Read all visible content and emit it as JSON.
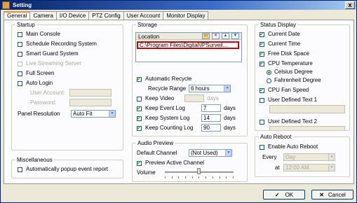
{
  "window": {
    "title": "Setting",
    "close_label": "x"
  },
  "tabs": [
    "General",
    "Camera",
    "I/O Device",
    "PTZ Config",
    "User Account",
    "Monitor Display"
  ],
  "startup": {
    "title": "Startup",
    "items": [
      {
        "label": "Main Console",
        "checked": false,
        "disabled": false
      },
      {
        "label": "Schedule Recording System",
        "checked": false,
        "disabled": false
      },
      {
        "label": "Smart Guard System",
        "checked": false,
        "disabled": false
      },
      {
        "label": "Live Streaming Server",
        "checked": false,
        "disabled": true
      },
      {
        "label": "Full Screen",
        "checked": false,
        "disabled": false
      },
      {
        "label": "Auto Login",
        "checked": false,
        "disabled": false
      }
    ],
    "user_account_label": "User Account:",
    "password_label": "Password:",
    "panel_resolution_label": "Panel Resolution",
    "panel_resolution_value": "Auto Fit"
  },
  "misc": {
    "title": "Miscellaneous",
    "popup_label": "Automatically popup event report"
  },
  "storage": {
    "title": "Storage",
    "location_header": "Location",
    "location_path": "C:\\Program Files\\Digital\\IPSurveil...",
    "toolbar_icons": [
      "folder-icon",
      "delete-icon",
      "up-icon",
      "down-icon"
    ],
    "auto_recycle_label": "Automatic Recycle",
    "recycle_range_label": "Recycle Range",
    "recycle_range_value": "6 hours",
    "keep_video_label": "Keep Video",
    "keep_video_value": "",
    "keep_event_label": "Keep Event Log",
    "keep_event_value": "7",
    "keep_system_label": "Keep System Log",
    "keep_system_value": "14",
    "keep_counting_label": "Keep Counting Log",
    "keep_counting_value": "90",
    "days_label": "days"
  },
  "audio": {
    "title": "Audio Preview",
    "default_channel_label": "Default Channel",
    "default_channel_value": "(Not Used)",
    "preview_label": "Preview Active Channel",
    "volume_label": "Volume",
    "volume_level": 0.5
  },
  "status": {
    "title": "Status Display",
    "current_date": "Current Date",
    "current_time": "Current Time",
    "free_disk": "Free Disk Space",
    "cpu_temp": "CPU Temperature",
    "celsius": "Celsius Degree",
    "fahrenheit": "Fahrenheit Degree",
    "cpu_fan": "CPU Fan Speed",
    "user_text1": "User Defined Text 1",
    "user_text2": "User Defined Text 2"
  },
  "reboot": {
    "title": "Auto Reboot",
    "enable_label": "Enable Auto Reboot",
    "every_label": "Every",
    "every_value": "Day",
    "at_label": "at",
    "at_value": "12:00 AM"
  },
  "buttons": {
    "ok": "OK",
    "cancel": "Cancel"
  },
  "colors": {
    "title_bar": "#0a246a",
    "tab_accent": "#e68b2c",
    "highlight_border": "#c00000",
    "check": "#21a121"
  }
}
